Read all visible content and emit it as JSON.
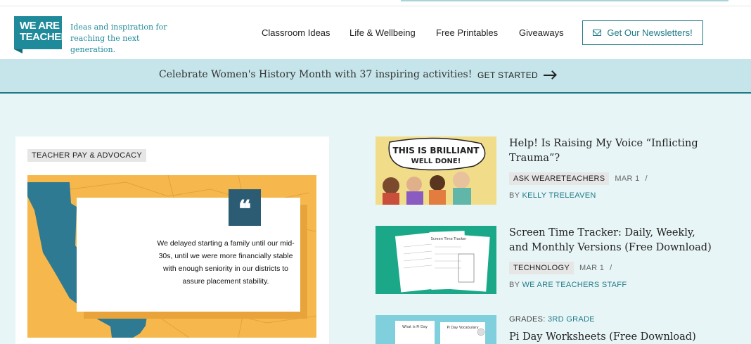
{
  "header": {
    "logo_line1": "WE ARE",
    "logo_line2": "TEACHERS",
    "tagline_line1": "Ideas and inspiration for",
    "tagline_line2": "reaching the next generation.",
    "nav": [
      "Classroom Ideas",
      "Life & Wellbeing",
      "Free Printables",
      "Giveaways"
    ],
    "newsletter_label": "Get Our Newsletters!"
  },
  "banner": {
    "message": "Celebrate Women's History Month with 37 inspiring activities!",
    "cta": "GET STARTED"
  },
  "feature": {
    "tag": "TEACHER PAY & ADVOCACY",
    "quote_mark": "66",
    "quote": "We delayed starting a family until our mid-30s, until we were more financially stable with enough seniority in our districts to assure placement stability."
  },
  "articles": [
    {
      "thumb_text_1": "THIS IS BRILLIANT",
      "thumb_text_2": "WELL DONE!",
      "title": "Help! Is Raising My Voice “Inflicting Trauma”?",
      "category": "ASK WEARETEACHERS",
      "date": "MAR 1",
      "sep": "/",
      "by_prefix": "BY",
      "author": "KELLY TRELEAVEN"
    },
    {
      "thumb_text_1": "Screen Time Tracker",
      "title": "Screen Time Tracker: Daily, Weekly, and Monthly Versions (Free Download)",
      "category": "TECHNOLOGY",
      "date": "MAR 1",
      "sep": "/",
      "by_prefix": "BY",
      "author": "WE ARE TEACHERS STAFF"
    },
    {
      "thumb_text_1": "What is Pi Day",
      "thumb_text_2": "Pi Day Vocabulary",
      "grades_label": "GRADES:",
      "grades_value": "3RD GRADE",
      "title": "Pi Day Worksheets (Free Download)"
    }
  ],
  "colors": {
    "brand_teal": "#1f8a9a",
    "banner_bg": "#c5e5ea",
    "page_bg": "#e8f5f7",
    "feature_orange": "#f6b84d",
    "state_blue": "#2f7a93"
  }
}
